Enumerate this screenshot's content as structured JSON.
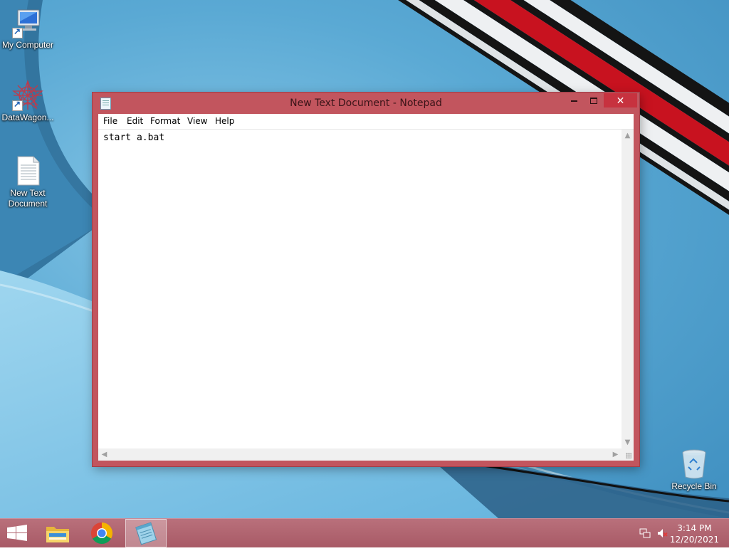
{
  "desktop": {
    "icons": [
      {
        "label": "My Computer",
        "icon": "computer-icon"
      },
      {
        "label": "DataWagon...",
        "icon": "datawagon-icon"
      },
      {
        "label": "New Text Document",
        "icon": "text-file-icon"
      },
      {
        "label": "Recycle Bin",
        "icon": "recycle-bin-icon"
      }
    ]
  },
  "window": {
    "title": "New Text Document - Notepad",
    "close_glyph": "✕",
    "menu": [
      "File",
      "Edit",
      "Format",
      "View",
      "Help"
    ],
    "content": "start a.bat",
    "scroll_arrows": {
      "up": "▲",
      "down": "▼",
      "left": "◀",
      "right": "▶"
    }
  },
  "taskbar": {
    "apps": [
      {
        "name": "start-button",
        "icon": "windows-logo-icon"
      },
      {
        "name": "file-explorer",
        "icon": "folder-icon"
      },
      {
        "name": "chrome",
        "icon": "chrome-icon"
      },
      {
        "name": "notepad",
        "icon": "notepad-icon",
        "active": true
      }
    ],
    "clock": {
      "time": "3:14 PM",
      "date": "12/20/2021"
    }
  },
  "colors": {
    "window_frame": "#c2555e",
    "taskbar": "#a85a66",
    "close_button": "#c7323f"
  }
}
